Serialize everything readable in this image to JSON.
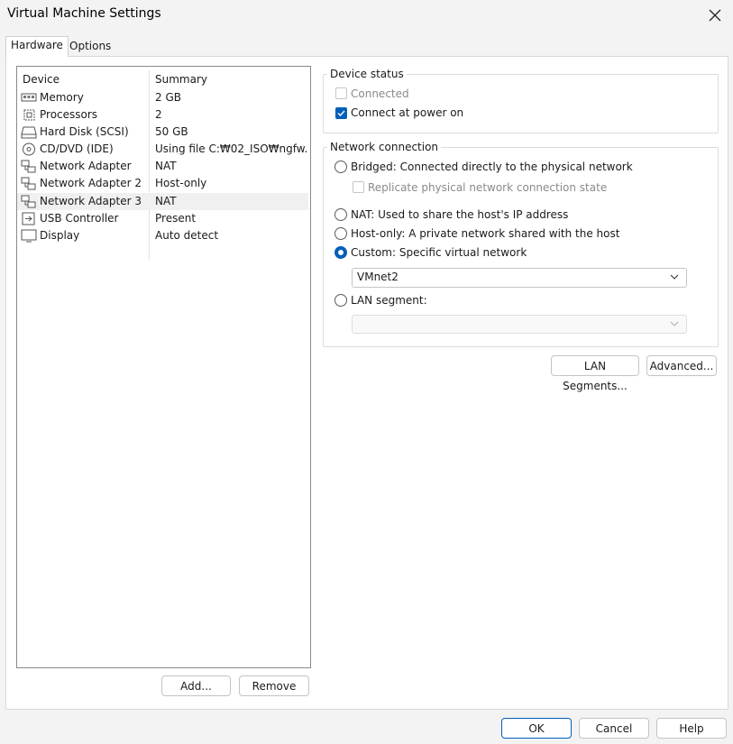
{
  "window": {
    "title": "Virtual Machine Settings"
  },
  "tabs": [
    {
      "label": "Hardware"
    },
    {
      "label": "Options"
    }
  ],
  "device_list": {
    "headers": {
      "device": "Device",
      "summary": "Summary"
    },
    "rows": [
      {
        "icon": "memory-icon",
        "name": "Memory",
        "summary": "2 GB"
      },
      {
        "icon": "processor-icon",
        "name": "Processors",
        "summary": "2"
      },
      {
        "icon": "hard-disk-icon",
        "name": "Hard Disk (SCSI)",
        "summary": "50 GB"
      },
      {
        "icon": "cd-dvd-icon",
        "name": "CD/DVD (IDE)",
        "summary": "Using file C:₩02_ISO₩ngfw..."
      },
      {
        "icon": "network-adapter-icon",
        "name": "Network Adapter",
        "summary": "NAT"
      },
      {
        "icon": "network-adapter-icon",
        "name": "Network Adapter 2",
        "summary": "Host-only"
      },
      {
        "icon": "network-adapter-icon",
        "name": "Network Adapter 3",
        "summary": "NAT",
        "selected": true
      },
      {
        "icon": "usb-icon",
        "name": "USB Controller",
        "summary": "Present"
      },
      {
        "icon": "display-icon",
        "name": "Display",
        "summary": "Auto detect"
      }
    ]
  },
  "list_buttons": {
    "add": "Add...",
    "remove": "Remove"
  },
  "device_status": {
    "title": "Device status",
    "connected": {
      "label": "Connected",
      "checked": false,
      "enabled": false
    },
    "connect_at_power_on": {
      "label": "Connect at power on",
      "checked": true
    }
  },
  "network_connection": {
    "title": "Network connection",
    "bridged": "Bridged: Connected directly to the physical network",
    "replicate": "Replicate physical network connection state",
    "nat": "NAT: Used to share the host's IP address",
    "host_only": "Host-only: A private network shared with the host",
    "custom": "Custom: Specific virtual network",
    "custom_value": "VMnet2",
    "lan_segment": "LAN segment:",
    "lan_segment_value": "",
    "selected": "custom"
  },
  "net_buttons": {
    "lan_segments": "LAN Segments...",
    "advanced": "Advanced..."
  },
  "footer": {
    "ok": "OK",
    "cancel": "Cancel",
    "help": "Help"
  },
  "colors": {
    "accent": "#005fb8",
    "selected_row": "#f0f0f0"
  }
}
